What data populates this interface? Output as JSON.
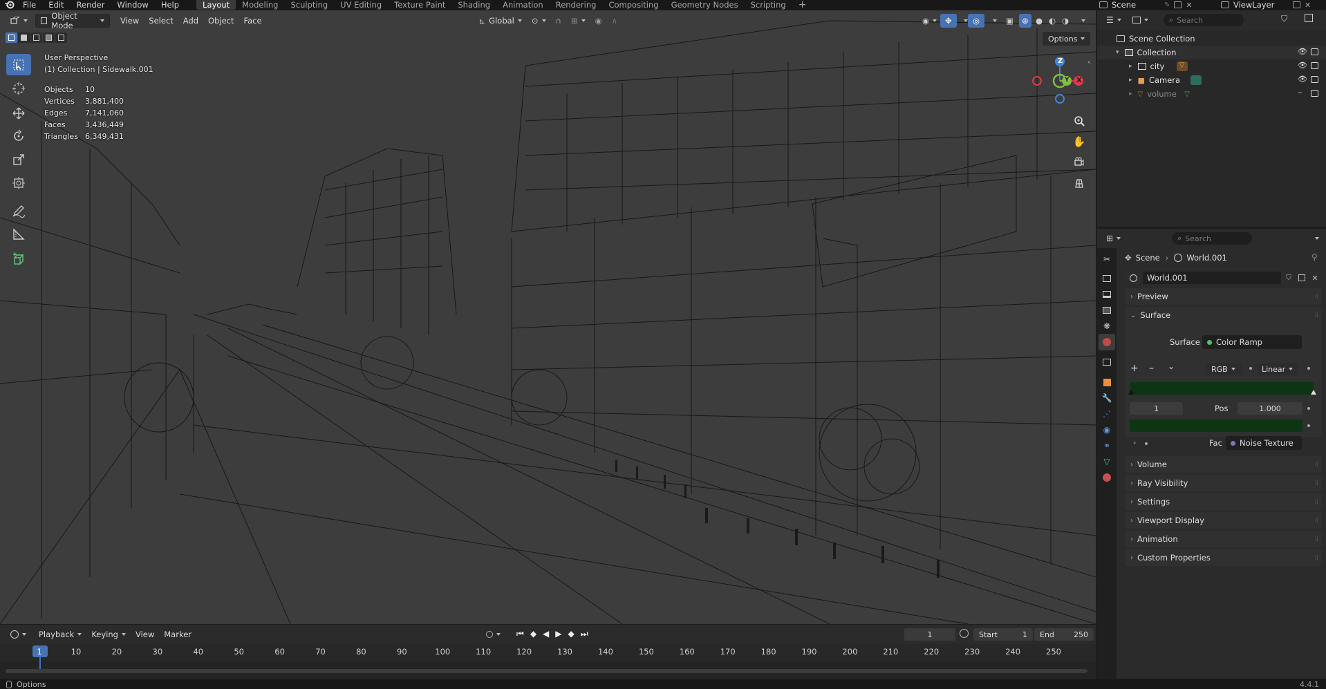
{
  "menu": [
    "File",
    "Edit",
    "Render",
    "Window",
    "Help"
  ],
  "workspaces": [
    "Layout",
    "Modeling",
    "Sculpting",
    "UV Editing",
    "Texture Paint",
    "Shading",
    "Animation",
    "Rendering",
    "Compositing",
    "Geometry Nodes",
    "Scripting"
  ],
  "top_right": {
    "scene": "Scene",
    "view_layer": "ViewLayer"
  },
  "viewport": {
    "mode": "Object Mode",
    "menus": [
      "View",
      "Select",
      "Add",
      "Object",
      "Face"
    ],
    "transform_orientation": "Global",
    "options_label": "Options",
    "perspective": "User Perspective",
    "collection_info": "(1) Collection | Sidewalk.001",
    "stats": [
      {
        "label": "Objects",
        "value": "10"
      },
      {
        "label": "Vertices",
        "value": "3,881,400"
      },
      {
        "label": "Edges",
        "value": "7,141,060"
      },
      {
        "label": "Faces",
        "value": "3,436,449"
      },
      {
        "label": "Triangles",
        "value": "6,349,431"
      }
    ],
    "gizmo": {
      "z": "Z",
      "x": "X",
      "y": "Y"
    },
    "colors": {
      "x_axis": "#e0384a",
      "y_axis": "#80c040",
      "z_axis": "#3f86d6"
    }
  },
  "timeline": {
    "menus": [
      "Playback",
      "Keying",
      "View",
      "Marker"
    ],
    "current_frame": "1",
    "start_label": "Start",
    "start": "1",
    "end_label": "End",
    "end": "250",
    "ticks": [
      "1",
      "10",
      "20",
      "30",
      "40",
      "50",
      "60",
      "70",
      "80",
      "90",
      "100",
      "110",
      "120",
      "130",
      "140",
      "150",
      "160",
      "170",
      "180",
      "190",
      "200",
      "210",
      "220",
      "230",
      "240",
      "250"
    ]
  },
  "status": {
    "left": "Options",
    "version": "4.4.1"
  },
  "outliner": {
    "search_placeholder": "Search",
    "root": "Scene Collection",
    "collection": "Collection",
    "items": [
      "city",
      "Camera",
      "volume"
    ]
  },
  "properties": {
    "search_placeholder": "Search",
    "breadcrumb": [
      "Scene",
      "World.001"
    ],
    "world_name": "World.001",
    "panels": {
      "preview": "Preview",
      "surface": "Surface"
    },
    "surface_label": "Surface",
    "surface_value": "Color Ramp",
    "color_mode": "RGB",
    "interpolation": "Linear",
    "stop_index": "1",
    "pos_label": "Pos",
    "pos_value": "1.000",
    "fac_label": "Fac",
    "fac_value": "Noise Texture",
    "collapsed_panels": [
      "Volume",
      "Ray Visibility",
      "Settings",
      "Viewport Display",
      "Animation",
      "Custom Properties"
    ],
    "colors": {
      "ramp": "#0e3513",
      "accent": "#4772b3"
    }
  }
}
